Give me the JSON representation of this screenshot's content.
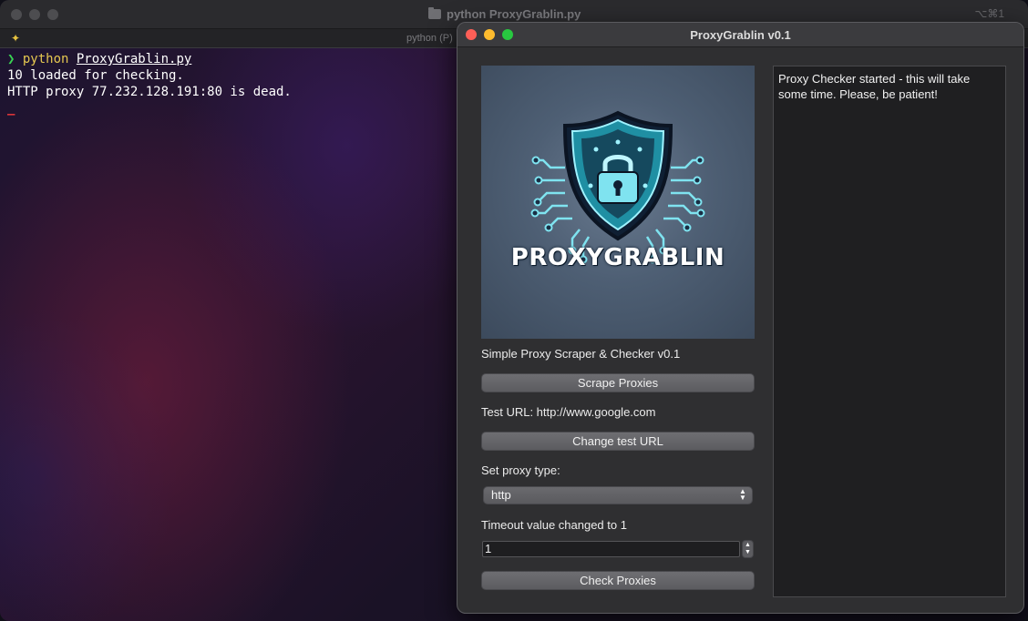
{
  "terminal": {
    "window_title": "python ProxyGrablin.py",
    "shortcut": "⌥⌘1",
    "tab_label": "python (P)",
    "lines": {
      "command_program": "python",
      "command_arg": "ProxyGrablin.py",
      "line2": "10 loaded for checking.",
      "line3": "HTTP proxy 77.232.128.191:80 is dead.",
      "cursor": "_"
    }
  },
  "app": {
    "title": "ProxyGrablin v0.1",
    "logo_text": "PROXYGRABLIN",
    "subtitle": "Simple Proxy Scraper & Checker v0.1",
    "scrape_button": "Scrape Proxies",
    "test_url_label": "Test URL: http://www.google.com",
    "change_url_button": "Change test URL",
    "proxy_type_label": "Set proxy type:",
    "proxy_type_selected": "http",
    "timeout_label": "Timeout value changed to 1",
    "timeout_value": "1",
    "check_button": "Check Proxies",
    "log_text": "Proxy Checker started - this will take some time. Please, be patient!"
  },
  "colors": {
    "close": "#fe5f57",
    "minimize": "#febc2e",
    "zoom": "#28c840",
    "prompt_arrow": "#39d353",
    "command": "#e5c750",
    "cursor": "#ff3b3b"
  }
}
